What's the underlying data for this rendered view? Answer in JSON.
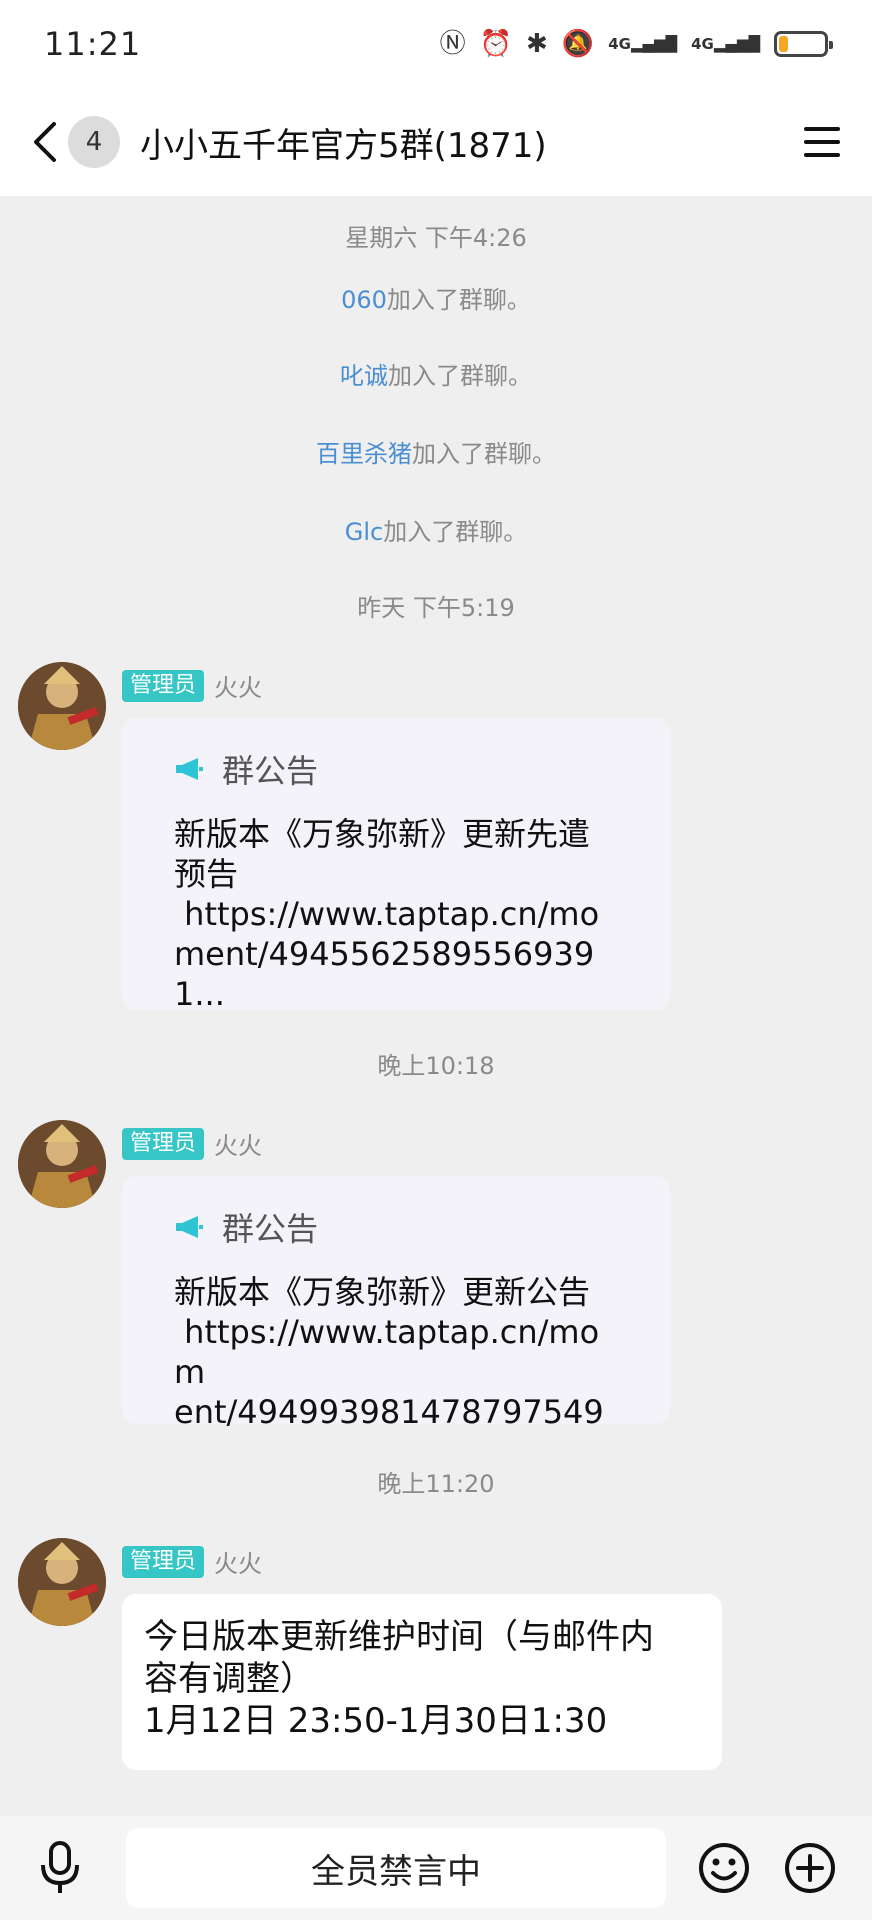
{
  "status_bar": {
    "time": "11:21",
    "net1": "4G",
    "net2": "4G",
    "battery_level": 0.2,
    "battery_color": "#f5a623"
  },
  "header": {
    "unread_count": "4",
    "title": "小小五千年官方5群(1871)"
  },
  "chat": {
    "timestamps": [
      "星期六 下午4:26",
      "昨天 下午5:19",
      "晚上10:18",
      "晚上11:20"
    ],
    "system_messages": [
      {
        "who": "060",
        "text": "加入了群聊。"
      },
      {
        "who": "叱诚",
        "text": "加入了群聊。"
      },
      {
        "who": "百里杀猪",
        "text": "加入了群聊。"
      },
      {
        "who": "Glc",
        "text": "加入了群聊。"
      }
    ],
    "messages": [
      {
        "role": "管理员",
        "sender": "火火",
        "notice_title": "群公告",
        "body": "新版本《万象弥新》更新先遣预告\n https://www.taptap.cn/moment/49455625895569391..."
      },
      {
        "role": "管理员",
        "sender": "火火",
        "notice_title": "群公告",
        "body": "新版本《万象弥新》更新公告\n https://www.taptap.cn/moment/494993981478797549"
      },
      {
        "role": "管理员",
        "sender": "火火",
        "body": "今日版本更新维护时间（与邮件内容有调整）\n1月12日 23:50-1月30日1:30"
      }
    ]
  },
  "bottom_bar": {
    "mute_text": "全员禁言中"
  },
  "colors": {
    "role_badge": "#37c6c6",
    "link_name": "#4a8fd4",
    "notice_icon": "#2ec4d6"
  },
  "icons": [
    "back-arrow-icon",
    "menu-icon",
    "megaphone-icon",
    "microphone-icon",
    "emoji-icon",
    "plus-icon"
  ]
}
